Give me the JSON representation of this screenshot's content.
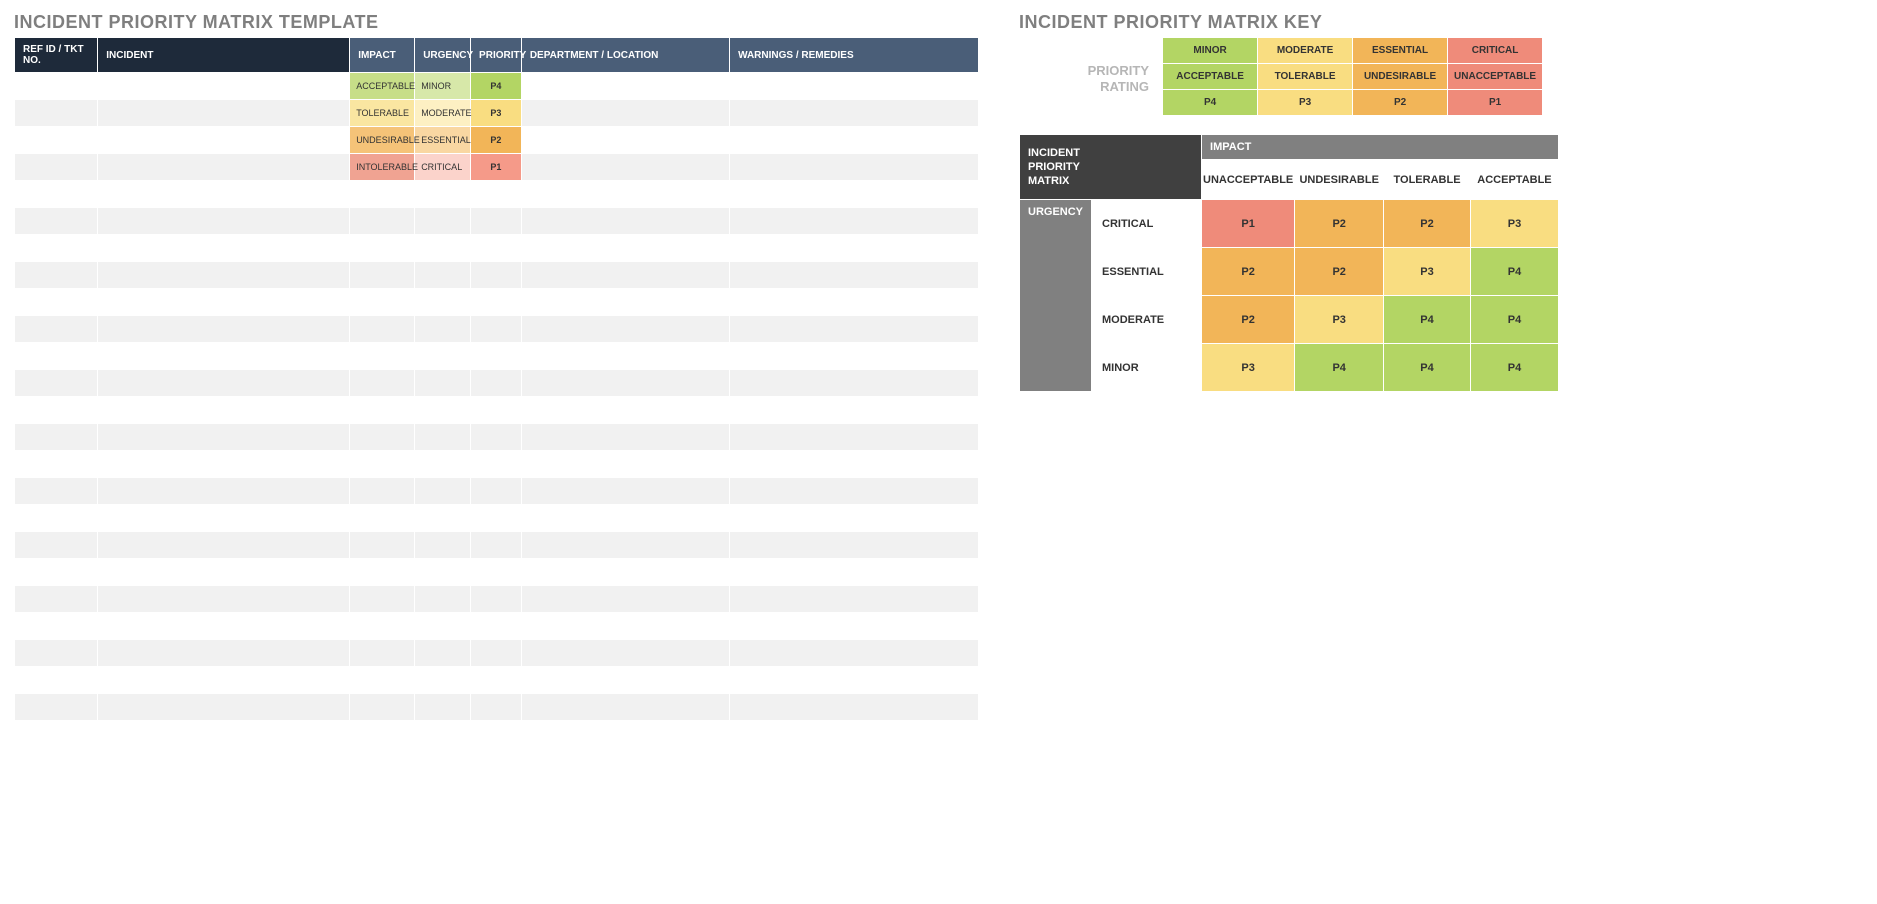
{
  "left": {
    "title": "INCIDENT PRIORITY MATRIX TEMPLATE",
    "headers": {
      "ref": "REF ID / TKT NO.",
      "incident": "INCIDENT",
      "impact": "IMPACT",
      "urgency": "URGENCY",
      "priority": "PRIORITY",
      "department": "DEPARTMENT / LOCATION",
      "warnings": "WARNINGS / REMEDIES"
    },
    "rows": [
      {
        "impact": "ACCEPTABLE",
        "impactCls": "impact-acceptable",
        "urgency": "MINOR",
        "urgCls": "urg-minor",
        "priority": "P4",
        "priCls": "p4"
      },
      {
        "impact": "TOLERABLE",
        "impactCls": "impact-tolerable",
        "urgency": "MODERATE",
        "urgCls": "urg-moderate",
        "priority": "P3",
        "priCls": "p3"
      },
      {
        "impact": "UNDESIRABLE",
        "impactCls": "impact-undesirable",
        "urgency": "ESSENTIAL",
        "urgCls": "urg-essential",
        "priority": "P2",
        "priCls": "p2"
      },
      {
        "impact": "INTOLERABLE",
        "impactCls": "impact-intolerable",
        "urgency": "CRITICAL",
        "urgCls": "urg-critical",
        "priority": "P1",
        "priCls": "p1b"
      }
    ],
    "extraBlankRows": 21
  },
  "right": {
    "title": "INCIDENT PRIORITY MATRIX KEY",
    "ratingLabel1": "PRIORITY",
    "ratingLabel2": "RATING",
    "ratingCols": [
      {
        "severity": "MINOR",
        "impact": "ACCEPTABLE",
        "p": "P4",
        "sevCls": "p4",
        "impCls": "p4",
        "pCls": "p4"
      },
      {
        "severity": "MODERATE",
        "impact": "TOLERABLE",
        "p": "P3",
        "sevCls": "p3",
        "impCls": "p3",
        "pCls": "p3"
      },
      {
        "severity": "ESSENTIAL",
        "impact": "UNDESIRABLE",
        "p": "P2",
        "sevCls": "p2",
        "impCls": "p2",
        "pCls": "p2"
      },
      {
        "severity": "CRITICAL",
        "impact": "UNACCEPTABLE",
        "p": "P1",
        "sevCls": "p1",
        "impCls": "p1",
        "pCls": "p1"
      }
    ],
    "matrix": {
      "cornerLine1": "INCIDENT",
      "cornerLine2": "PRIORITY",
      "cornerLine3": "MATRIX",
      "impactLabel": "IMPACT",
      "urgencyLabel": "URGENCY",
      "impactCols": [
        "UNACCEPTABLE",
        "UNDESIRABLE",
        "TOLERABLE",
        "ACCEPTABLE"
      ],
      "urgencyRows": [
        "CRITICAL",
        "ESSENTIAL",
        "MODERATE",
        "MINOR"
      ],
      "cells": [
        [
          {
            "v": "P1",
            "c": "p1"
          },
          {
            "v": "P2",
            "c": "p2"
          },
          {
            "v": "P2",
            "c": "p2"
          },
          {
            "v": "P3",
            "c": "p3"
          }
        ],
        [
          {
            "v": "P2",
            "c": "p2"
          },
          {
            "v": "P2",
            "c": "p2"
          },
          {
            "v": "P3",
            "c": "p3"
          },
          {
            "v": "P4",
            "c": "p4"
          }
        ],
        [
          {
            "v": "P2",
            "c": "p2"
          },
          {
            "v": "P3",
            "c": "p3"
          },
          {
            "v": "P4",
            "c": "p4"
          },
          {
            "v": "P4",
            "c": "p4"
          }
        ],
        [
          {
            "v": "P3",
            "c": "p3"
          },
          {
            "v": "P4",
            "c": "p4"
          },
          {
            "v": "P4",
            "c": "p4"
          },
          {
            "v": "P4",
            "c": "p4"
          }
        ]
      ]
    }
  }
}
